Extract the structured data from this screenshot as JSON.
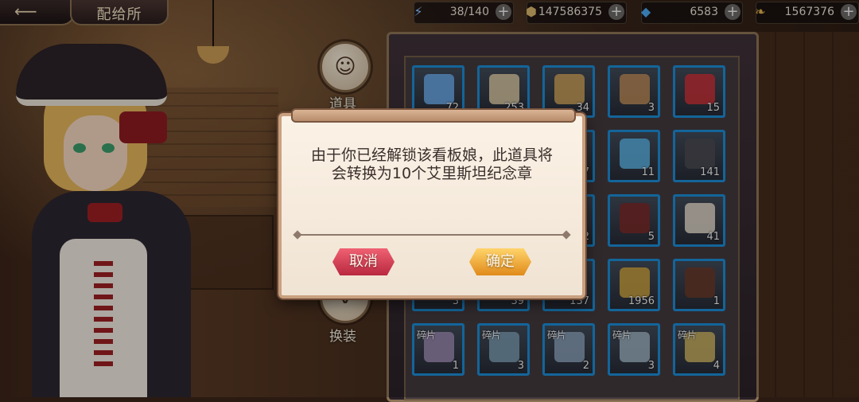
{
  "header": {
    "title": "配给所",
    "resources": [
      {
        "icon": "lightning-icon",
        "value": "38/140"
      },
      {
        "icon": "coin-icon",
        "value": "147586375"
      },
      {
        "icon": "blue-gem-icon",
        "value": "6583"
      },
      {
        "icon": "gold-leaf-icon",
        "value": "1567376"
      }
    ]
  },
  "side_menu": {
    "items": [
      {
        "label": "道具"
      },
      {
        "label": "换装"
      }
    ]
  },
  "inventory": {
    "slots": [
      {
        "qty": "72",
        "tag": ""
      },
      {
        "qty": "253",
        "tag": ""
      },
      {
        "qty": "34",
        "tag": ""
      },
      {
        "qty": "3",
        "tag": ""
      },
      {
        "qty": "15",
        "tag": ""
      },
      {
        "qty": "",
        "tag": ""
      },
      {
        "qty": "",
        "tag": ""
      },
      {
        "qty": "37",
        "tag": ""
      },
      {
        "qty": "11",
        "tag": ""
      },
      {
        "qty": "141",
        "tag": ""
      },
      {
        "qty": "",
        "tag": ""
      },
      {
        "qty": "",
        "tag": ""
      },
      {
        "qty": "2",
        "tag": ""
      },
      {
        "qty": "5",
        "tag": ""
      },
      {
        "qty": "41",
        "tag": ""
      },
      {
        "qty": "3",
        "tag": ""
      },
      {
        "qty": "39",
        "tag": ""
      },
      {
        "qty": "137",
        "tag": ""
      },
      {
        "qty": "1956",
        "tag": ""
      },
      {
        "qty": "1",
        "tag": ""
      },
      {
        "qty": "1",
        "tag": "碎片"
      },
      {
        "qty": "3",
        "tag": "碎片"
      },
      {
        "qty": "2",
        "tag": "碎片"
      },
      {
        "qty": "3",
        "tag": "碎片"
      },
      {
        "qty": "4",
        "tag": "碎片"
      }
    ]
  },
  "dialog": {
    "message": "由于你已经解锁该看板娘，此道具将会转换为10个艾里斯坦纪念章",
    "cancel_label": "取消",
    "confirm_label": "确定"
  },
  "colors": {
    "slot_border": "#1b8dd6",
    "cancel_button": "#d8354c",
    "confirm_button": "#f0a22a"
  }
}
